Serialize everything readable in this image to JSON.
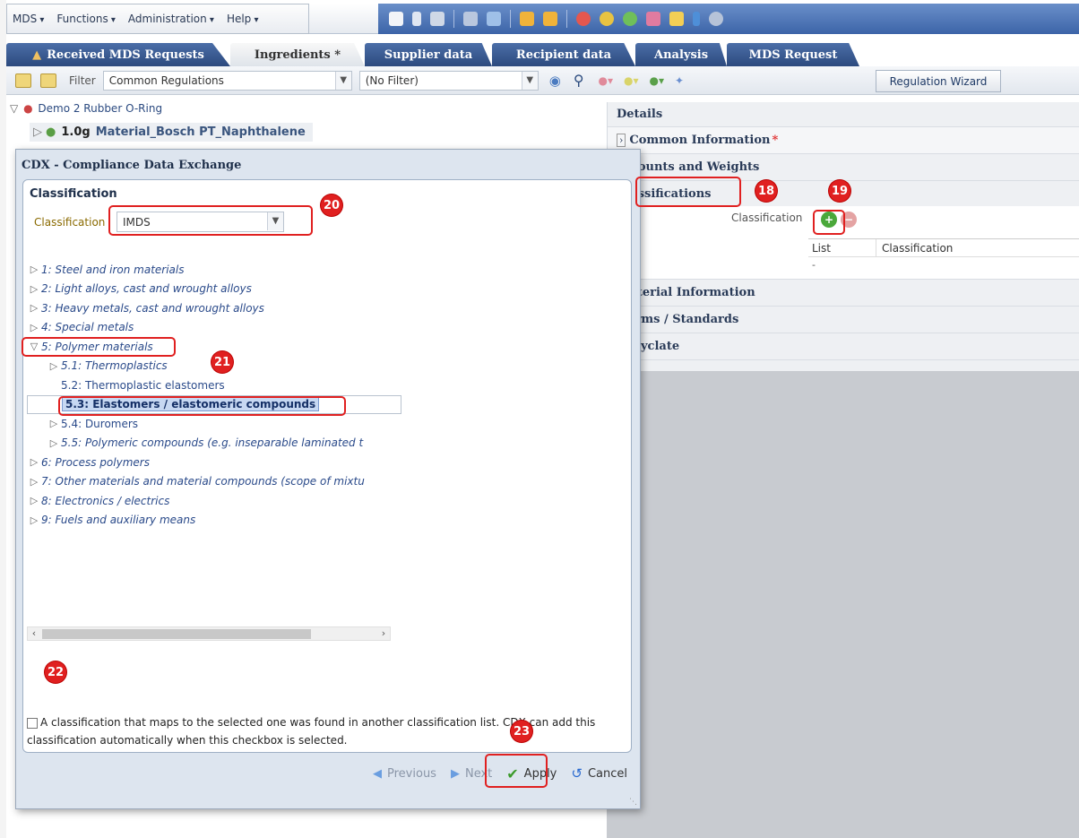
{
  "menubar": {
    "items": [
      "MDS",
      "Functions",
      "Administration",
      "Help"
    ]
  },
  "tabs": [
    {
      "label": "Received MDS Requests"
    },
    {
      "label": "Ingredients *"
    },
    {
      "label": "Supplier data"
    },
    {
      "label": "Recipient data"
    },
    {
      "label": "Analysis"
    },
    {
      "label": "MDS Request"
    }
  ],
  "filterbar": {
    "filter_label": "Filter",
    "filter_value": "Common Regulations",
    "second_filter_value": "(No Filter)",
    "regulation_wizard": "Regulation Wizard"
  },
  "tree": {
    "root": "Demo 2 Rubber O-Ring",
    "child_weight": "1.0g",
    "child_name": "Material_Bosch PT_Naphthalene"
  },
  "details": {
    "title": "Details",
    "common_information": "Common Information",
    "required_mark": "*",
    "amounts_and_weights": "Amounts and Weights",
    "classifications": "Classifications",
    "classification_label": "Classification",
    "table_headers": [
      "List",
      "Classification"
    ],
    "table_empty_cell": "-",
    "material_information": "Material Information",
    "norms_standards": "Norms / Standards",
    "recyclate": "Recyclate"
  },
  "dialog": {
    "title": "CDX - Compliance Data Exchange",
    "section_header": "Classification",
    "classification_label": "Classification",
    "classification_value": "IMDS",
    "tree_items": [
      {
        "label": "1: Steel and iron materials",
        "level": 0,
        "toggle": "closed",
        "style": "italic"
      },
      {
        "label": "2: Light alloys, cast and wrought alloys",
        "level": 0,
        "toggle": "closed",
        "style": "italic"
      },
      {
        "label": "3: Heavy metals, cast and wrought alloys",
        "level": 0,
        "toggle": "closed",
        "style": "italic"
      },
      {
        "label": "4: Special metals",
        "level": 0,
        "toggle": "closed",
        "style": "italic"
      },
      {
        "label": "5: Polymer materials",
        "level": 0,
        "toggle": "open",
        "style": "italic"
      },
      {
        "label": "5.1: Thermoplastics",
        "level": 1,
        "toggle": "closed",
        "style": "italic"
      },
      {
        "label": "5.2: Thermoplastic elastomers",
        "level": 1,
        "toggle": "none",
        "style": "plain"
      },
      {
        "label": "5.3: Elastomers / elastomeric compounds",
        "level": 1,
        "toggle": "none",
        "style": "selected"
      },
      {
        "label": "5.4: Duromers",
        "level": 1,
        "toggle": "closed",
        "style": "plain"
      },
      {
        "label": "5.5: Polymeric compounds (e.g. inseparable laminated t",
        "level": 1,
        "toggle": "closed",
        "style": "italic"
      },
      {
        "label": "6: Process polymers",
        "level": 0,
        "toggle": "closed",
        "style": "italic"
      },
      {
        "label": "7: Other materials and material compounds (scope of mixtu",
        "level": 0,
        "toggle": "closed",
        "style": "italic"
      },
      {
        "label": "8: Electronics / electrics",
        "level": 0,
        "toggle": "closed",
        "style": "italic"
      },
      {
        "label": "9: Fuels and auxiliary means",
        "level": 0,
        "toggle": "closed",
        "style": "italic"
      }
    ],
    "checkbox_text": "A classification that maps to the selected one was found in another classification list. CDX can add this classification automatically when this checkbox is selected.",
    "previous": "Previous",
    "next": "Next",
    "apply": "Apply",
    "cancel": "Cancel"
  },
  "annotations": [
    "18",
    "19",
    "20",
    "21",
    "22",
    "23"
  ],
  "colors": {
    "accent_blue": "#2c4a7e",
    "annotation_red": "#e02020",
    "selection_bg": "#c7d8f2"
  }
}
